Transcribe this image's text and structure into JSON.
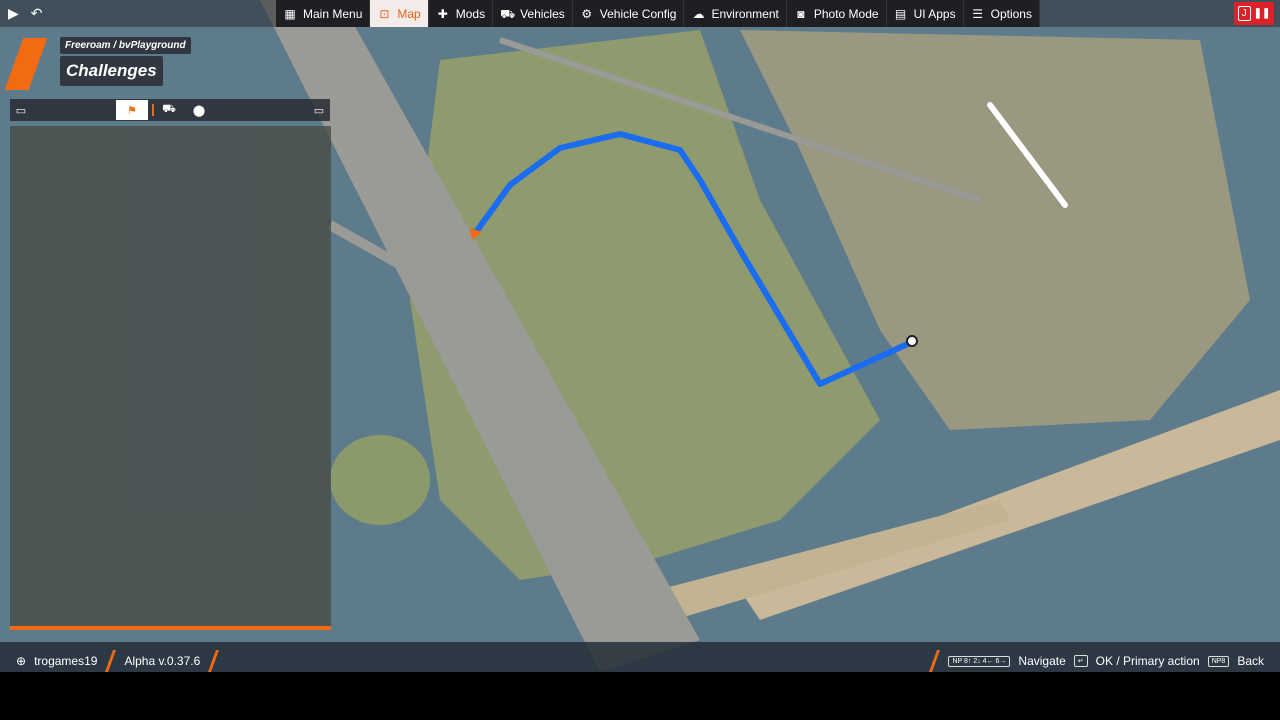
{
  "topbar": {
    "menu": [
      {
        "label": "Main Menu",
        "icon": "main-menu-icon"
      },
      {
        "label": "Map",
        "icon": "map-icon",
        "active": true
      },
      {
        "label": "Mods",
        "icon": "puzzle-icon"
      },
      {
        "label": "Vehicles",
        "icon": "car-icon"
      },
      {
        "label": "Vehicle Config",
        "icon": "engine-icon"
      },
      {
        "label": "Environment",
        "icon": "weather-icon"
      },
      {
        "label": "Photo Mode",
        "icon": "camera-icon"
      },
      {
        "label": "UI Apps",
        "icon": "apps-icon"
      },
      {
        "label": "Options",
        "icon": "sliders-icon"
      }
    ],
    "pause_key": "J"
  },
  "header": {
    "breadcrumb": "Freeroam / bvPlayground",
    "title": "Challenges"
  },
  "footer": {
    "user": "trogames19",
    "version": "Alpha v.0.37.6",
    "hints": [
      {
        "key": "NP 8↑ 2↓ 4← 6→",
        "label": "Navigate"
      },
      {
        "key": "↵",
        "label": "OK / Primary action"
      },
      {
        "key": "NP8",
        "label": "Back"
      }
    ]
  },
  "colors": {
    "accent": "#f26a11",
    "route": "#1a6cf0",
    "water": "#5e7b8c"
  }
}
